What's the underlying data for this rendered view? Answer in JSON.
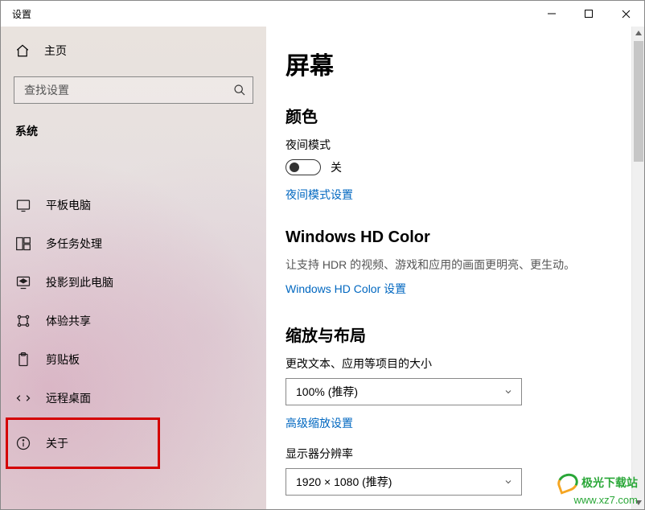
{
  "window": {
    "title": "设置"
  },
  "sidebar": {
    "home_label": "主页",
    "search_placeholder": "查找设置",
    "section_label": "系统",
    "items": [
      {
        "label": "平板电脑"
      },
      {
        "label": "多任务处理"
      },
      {
        "label": "投影到此电脑"
      },
      {
        "label": "体验共享"
      },
      {
        "label": "剪贴板"
      },
      {
        "label": "远程桌面"
      },
      {
        "label": "关于"
      }
    ]
  },
  "main": {
    "title": "屏幕",
    "color": {
      "heading": "颜色",
      "night_mode_label": "夜间模式",
      "toggle_state": "关",
      "night_mode_link": "夜间模式设置"
    },
    "hdcolor": {
      "heading": "Windows HD Color",
      "desc": "让支持 HDR 的视频、游戏和应用的画面更明亮、更生动。",
      "link": "Windows HD Color 设置"
    },
    "scale": {
      "heading": "缩放与布局",
      "size_label": "更改文本、应用等项目的大小",
      "size_value": "100% (推荐)",
      "adv_link": "高级缩放设置",
      "res_label": "显示器分辨率",
      "res_value": "1920 × 1080 (推荐)"
    }
  },
  "watermark": {
    "name": "极光下载站",
    "url": "www.xz7.com"
  }
}
